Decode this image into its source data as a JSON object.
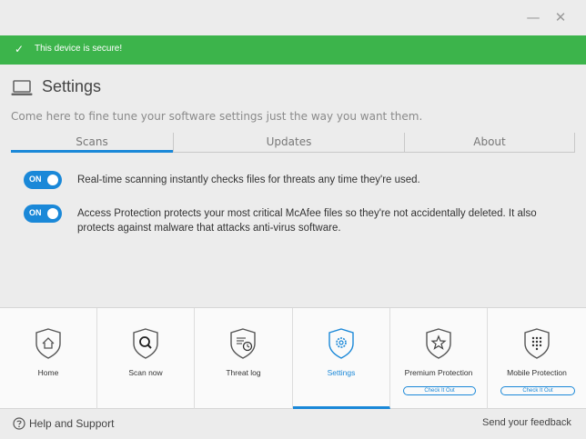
{
  "window": {
    "minimize_glyph": "—",
    "close_glyph": "✕"
  },
  "banner": {
    "text": "This device is secure!",
    "color": "#3cb44b",
    "icon": "check-icon"
  },
  "page": {
    "title": "Settings",
    "title_icon": "laptop-icon",
    "subtitle": "Come here to fine tune your software settings just the way you want them."
  },
  "tabs": [
    {
      "label": "Scans",
      "selected": true
    },
    {
      "label": "Updates",
      "selected": false
    },
    {
      "label": "About",
      "selected": false
    }
  ],
  "settings": [
    {
      "toggle": "ON",
      "text": "Real-time scanning instantly checks files for threats any time they're used."
    },
    {
      "toggle": "ON",
      "text": "Access Protection protects your most critical McAfee files so they're not accidentally deleted. It also protects against malware that attacks anti-virus software."
    }
  ],
  "tiles": [
    {
      "label": "Home",
      "icon": "home-icon"
    },
    {
      "label": "Scan now",
      "icon": "magnifier-icon"
    },
    {
      "label": "Threat log",
      "icon": "log-clock-icon"
    },
    {
      "label": "Settings",
      "icon": "gear-icon",
      "active": true
    },
    {
      "label": "Premium Protection",
      "icon": "star-icon",
      "button": "Check It Out"
    },
    {
      "label": "Mobile Protection",
      "icon": "keypad-icon",
      "button": "Check It Out"
    }
  ],
  "footer": {
    "help": "Help and Support",
    "feedback": "Send your feedback"
  },
  "colors": {
    "accent": "#1a88d8",
    "success": "#3cb44b"
  }
}
